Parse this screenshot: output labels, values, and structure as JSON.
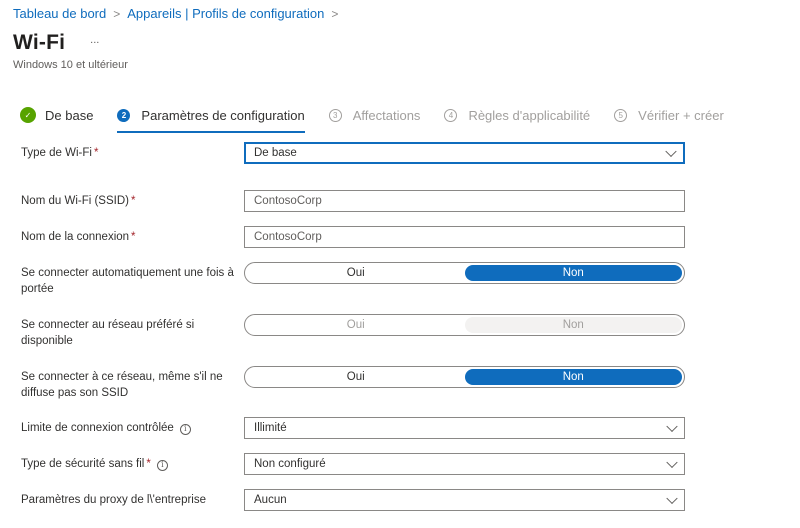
{
  "breadcrumb": {
    "items": [
      "Tableau de bord",
      "Appareils | Profils de configuration"
    ],
    "separator": ">"
  },
  "header": {
    "title": "Wi-Fi",
    "more": "...",
    "subtitle": "Windows 10 et ultérieur"
  },
  "steps": [
    {
      "number": "✓",
      "label": "De base",
      "state": "done"
    },
    {
      "number": "2",
      "label": "Paramètres de configuration",
      "state": "current"
    },
    {
      "number": "3",
      "label": "Affectations",
      "state": "future"
    },
    {
      "number": "4",
      "label": "Règles d'applicabilité",
      "state": "future"
    },
    {
      "number": "5",
      "label": "Vérifier + créer",
      "state": "future"
    }
  ],
  "form": {
    "wifi_type": {
      "label": "Type de Wi-Fi",
      "required": "*",
      "value": "De base"
    },
    "ssid": {
      "label": "Nom du Wi-Fi (SSID)",
      "required": "*",
      "value": "ContosoCorp"
    },
    "connection_name": {
      "label": "Nom de la connexion",
      "required": "*",
      "value": "ContosoCorp"
    },
    "auto_connect": {
      "label": "Se connecter automatiquement une fois à portée",
      "options": [
        "Oui",
        "Non"
      ],
      "selected": "Non",
      "disabled": false
    },
    "preferred_network": {
      "label": "Se connecter au réseau préféré si disponible",
      "options": [
        "Oui",
        "Non"
      ],
      "selected": "Non",
      "disabled": true
    },
    "hidden_network": {
      "label": "Se connecter à ce réseau, même s'il ne diffuse pas son SSID",
      "options": [
        "Oui",
        "Non"
      ],
      "selected": "Non",
      "disabled": false
    },
    "metered": {
      "label": "Limite de connexion contrôlée",
      "info": "i",
      "value": "Illimité"
    },
    "security_type": {
      "label": "Type de sécurité sans fil",
      "required": "*",
      "info": "i",
      "value": "Non configuré"
    },
    "proxy": {
      "label": "Paramètres du proxy de l\\'entreprise",
      "value": "Aucun"
    }
  },
  "colors": {
    "accent": "#0f6cbd",
    "success": "#57a300",
    "required": "#a4262c",
    "disabled_fill": "#f3f2f1"
  }
}
